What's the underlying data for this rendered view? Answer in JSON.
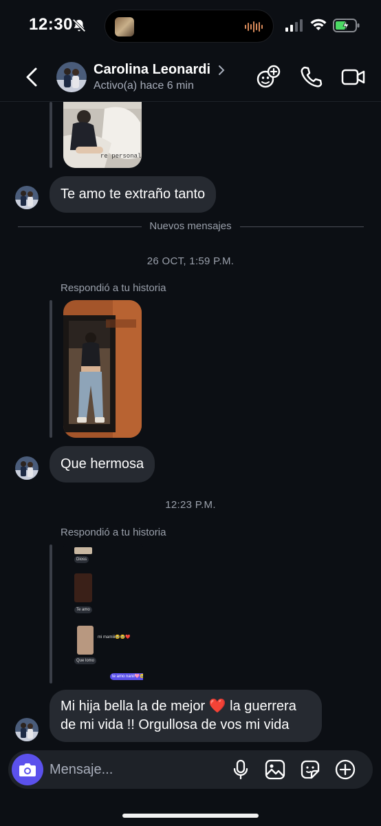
{
  "status_bar": {
    "time": "12:30"
  },
  "header": {
    "contact_name": "Carolina Leonardi",
    "contact_status": "Activo(a) hace 6 min"
  },
  "thread": {
    "story1_caption": "re personal",
    "message1": "Te amo te extraño tanto",
    "new_messages_label": "Nuevos mensajes",
    "timestamp1": "26 OCT, 1:59 P.M.",
    "replied_label_1": "Respondió a tu historia",
    "message2": "Que hermosa",
    "timestamp2": "12:23 P.M.",
    "replied_label_2": "Respondió a tu historia",
    "message3_part1": "Mi hija bella la de mejor ",
    "message3_emoji": "❤️",
    "message3_part2": " la guerrera de mi vida !! Orgullosa de vos mi vida"
  },
  "mini_chat": {
    "msg_a": "Dioss",
    "msg_b": "Te amo",
    "msg_c": "mi mamiii🥹🥹❤️",
    "msg_d": "Que lomo",
    "msg_e": "te amo nanii🩷🥹"
  },
  "composer": {
    "placeholder": "Mensaje..."
  },
  "colors": {
    "background": "#0c0f14",
    "bubble": "#262a31",
    "accent_camera": "#5b51ec",
    "muted_text": "#9aa0ab"
  }
}
